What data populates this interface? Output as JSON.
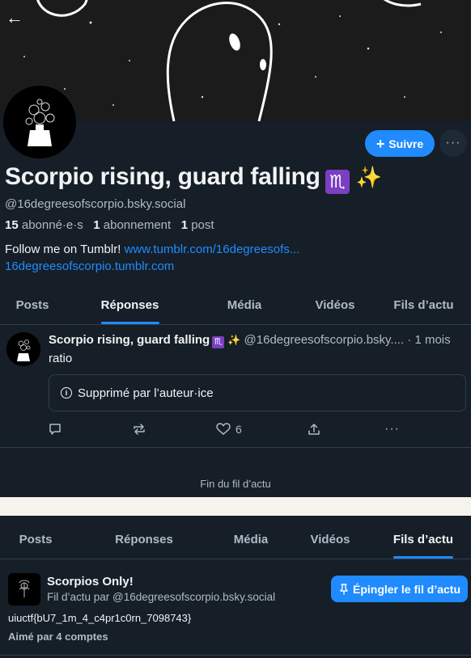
{
  "header": {
    "display_name": "Scorpio rising, guard falling",
    "emoji_scorpio": "♏",
    "emoji_sparkles": "✨",
    "handle": "@16degreesofscorpio.bsky.social",
    "follow_label": "Suivre",
    "more_label": "···"
  },
  "stats": {
    "followers_count": "15",
    "followers_label": "abonné·e·s",
    "following_count": "1",
    "following_label": "abonnement",
    "posts_count": "1",
    "posts_label": "post"
  },
  "bio": {
    "text": "Follow me on Tumblr!",
    "link1": "www.tumblr.com/16degreesofs...",
    "link2": "16degreesofscorpio.tumblr.com"
  },
  "tabs": [
    "Posts",
    "Réponses",
    "Média",
    "Vidéos",
    "Fils d’actu"
  ],
  "post": {
    "author_name": "Scorpio rising, guard falling",
    "emoji_scorpio": "♏",
    "emoji_sparkles": "✨",
    "author_handle": "@16degreesofscorpio.bsky....",
    "time": " · 1 mois",
    "text": "ratio",
    "deleted_notice": "Supprimé par l’auteur·ice",
    "like_count": "6"
  },
  "end_of_feed": "Fin du fil d’actu",
  "feed": {
    "name": "Scorpios Only!",
    "by": "Fil d’actu par @16degreesofscorpio.bsky.social",
    "pin_label": "Épingler le fil d’actu",
    "description": "uiuctf{bU7_1m_4_c4pr1c0rn_7098743}",
    "liked_by": "Aimé par 4 comptes"
  },
  "colors": {
    "background": "#161e27",
    "accent": "#208bfe",
    "muted_text": "#aebbc9",
    "border": "#2e4052"
  }
}
